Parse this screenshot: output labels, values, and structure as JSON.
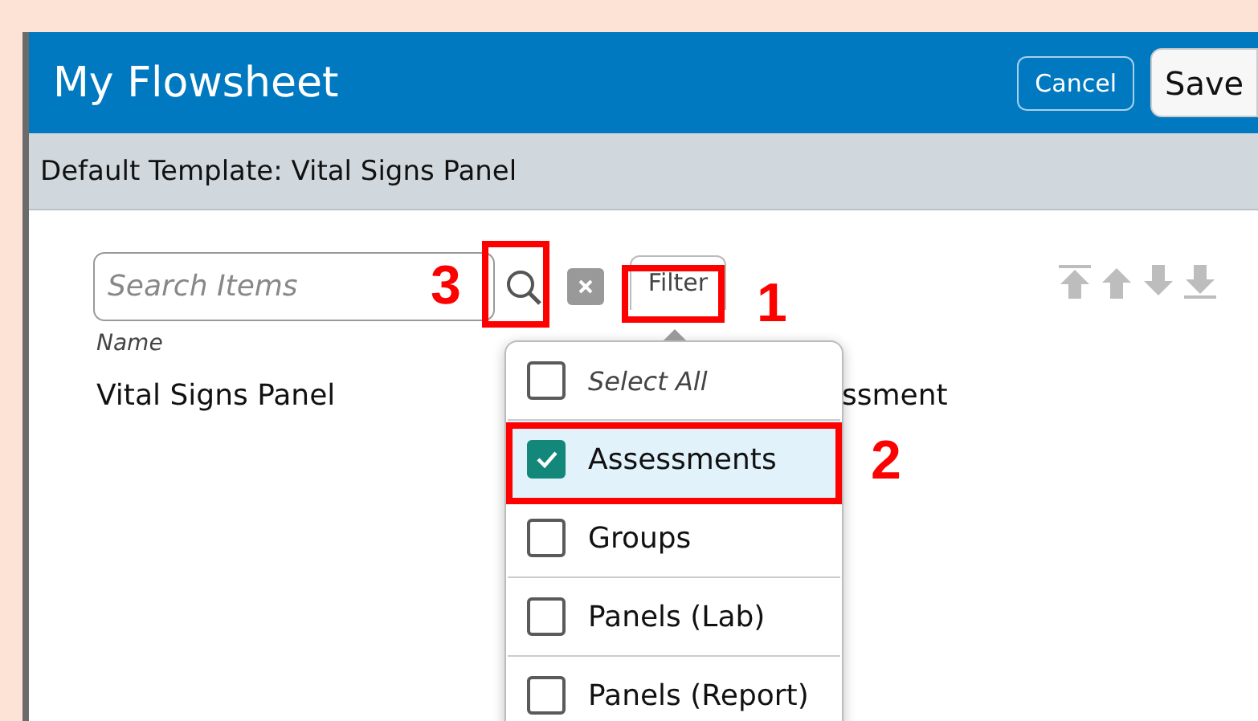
{
  "window": {
    "title": "My Flowsheet"
  },
  "header_buttons": [
    {
      "label": "Cancel",
      "kind": "outline"
    },
    {
      "label": "Save",
      "kind": "solid"
    }
  ],
  "template_bar": {
    "text": "Default Template: Vital Signs Panel"
  },
  "search": {
    "placeholder": "Search Items"
  },
  "filter_button": {
    "label": "Filter"
  },
  "columns": [
    "Name"
  ],
  "rows": [
    {
      "name": "Vital Signs Panel",
      "type": "ssment"
    }
  ],
  "filter_menu": {
    "items": [
      {
        "label": "Select All",
        "kind": "select-all",
        "checked": false,
        "selected": false
      },
      {
        "label": "Assessments",
        "kind": "option",
        "checked": true,
        "selected": true
      },
      {
        "label": "Groups",
        "kind": "option",
        "checked": false,
        "selected": false
      },
      {
        "label": "Panels (Lab)",
        "kind": "option",
        "checked": false,
        "selected": false
      },
      {
        "label": "Panels (Report)",
        "kind": "option",
        "checked": false,
        "selected": false
      }
    ]
  },
  "annotations": [
    {
      "label": "1",
      "kind": "filter"
    },
    {
      "label": "2",
      "kind": "menu-item"
    },
    {
      "label": "3",
      "kind": "search"
    }
  ]
}
